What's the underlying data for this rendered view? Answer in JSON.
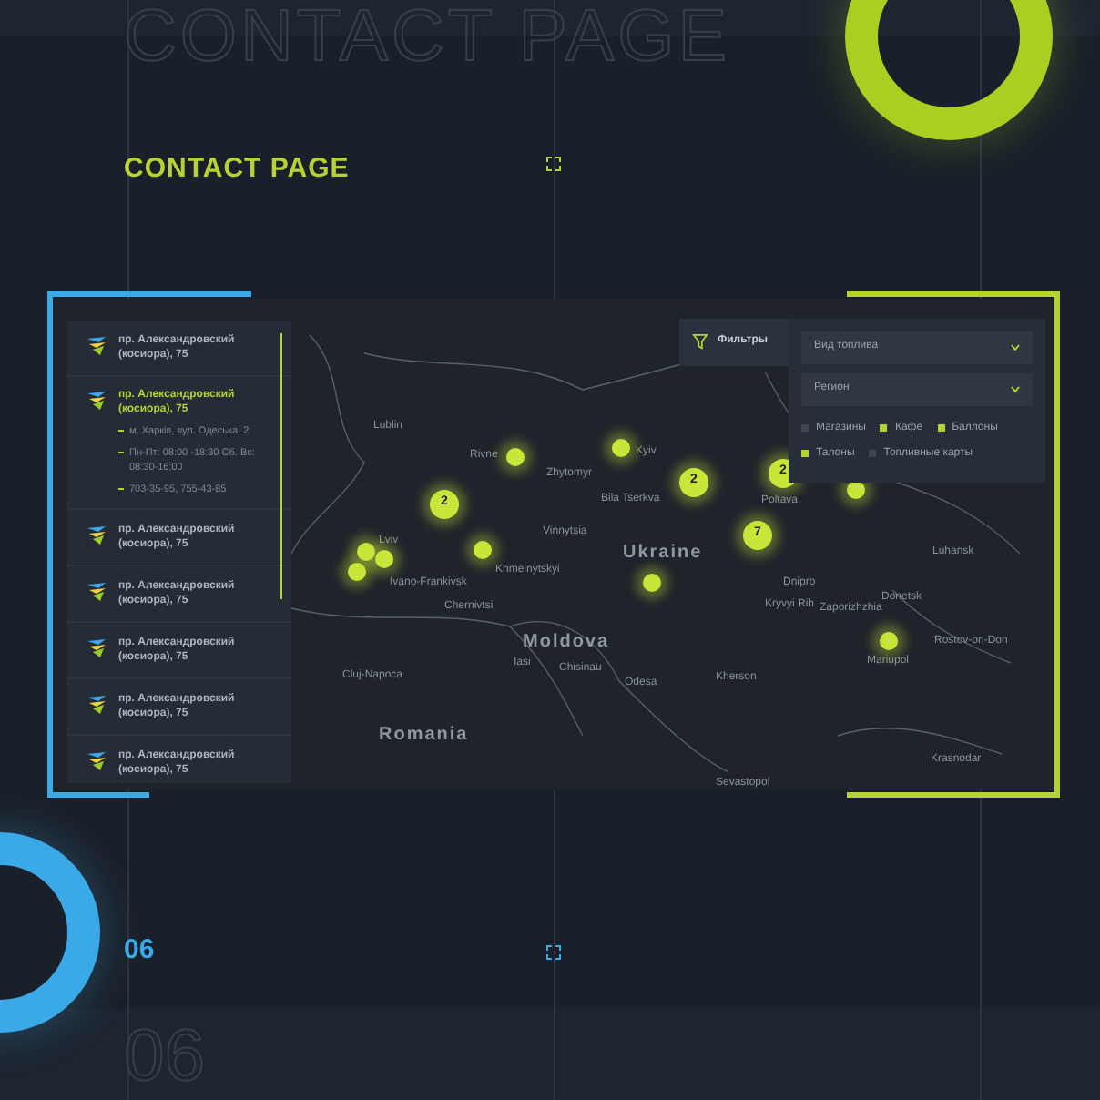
{
  "backdrop_title": "CONTACT PAGE",
  "page_title": "CONTACT PAGE",
  "page_number": "06",
  "backdrop_number": "06",
  "locations": [
    {
      "title": "пр. Александровский (косиора), 75",
      "expanded": false
    },
    {
      "title": "пр. Александровский (косиора), 75",
      "expanded": true,
      "details": [
        "м. Харків, вул. Одеська, 2",
        "Пн-Пт: 08:00 -18:30 Сб. Вс: 08:30-16:00",
        "703-35-95, 755-43-85"
      ]
    },
    {
      "title": "пр. Александровский (косиора), 75",
      "expanded": false
    },
    {
      "title": "пр. Александровский (косиора), 75",
      "expanded": false
    },
    {
      "title": "пр. Александровский (косиора), 75",
      "expanded": false
    },
    {
      "title": "пр. Александровский (косиора), 75",
      "expanded": false
    },
    {
      "title": "пр. Александровский (косиора), 75",
      "expanded": false
    }
  ],
  "filters": {
    "button": "Фильтры",
    "selects": [
      {
        "placeholder": "Вид топлива"
      },
      {
        "placeholder": "Регион"
      }
    ],
    "options": [
      {
        "label": "Магазины",
        "checked": false
      },
      {
        "label": "Кафе",
        "checked": true
      },
      {
        "label": "Баллоны",
        "checked": true
      },
      {
        "label": "Талоны",
        "checked": true
      },
      {
        "label": "Топливные карты",
        "checked": false
      }
    ]
  },
  "map": {
    "labels": [
      {
        "text": "Lublin",
        "kind": "city"
      },
      {
        "text": "Lviv",
        "kind": "city"
      },
      {
        "text": "Rivne",
        "kind": "city"
      },
      {
        "text": "Zhytomyr",
        "kind": "city"
      },
      {
        "text": "Kyiv",
        "kind": "city"
      },
      {
        "text": "Bila Tserkva",
        "kind": "city"
      },
      {
        "text": "Ivano-Frankivsk",
        "kind": "city"
      },
      {
        "text": "Khmelnytskyi",
        "kind": "city"
      },
      {
        "text": "Vinnytsia",
        "kind": "city"
      },
      {
        "text": "Chernivtsi",
        "kind": "city"
      },
      {
        "text": "Ukraine",
        "kind": "country"
      },
      {
        "text": "Moldova",
        "kind": "country"
      },
      {
        "text": "Chisinau",
        "kind": "city"
      },
      {
        "text": "Iasi",
        "kind": "city"
      },
      {
        "text": "Odesa",
        "kind": "city"
      },
      {
        "text": "Cluj-Napoca",
        "kind": "city"
      },
      {
        "text": "Romania",
        "kind": "country"
      },
      {
        "text": "Poltava",
        "kind": "city"
      },
      {
        "text": "Dnipro",
        "kind": "city"
      },
      {
        "text": "Kryvyi Rih",
        "kind": "city"
      },
      {
        "text": "Zaporizhzhia",
        "kind": "city"
      },
      {
        "text": "Donetsk",
        "kind": "city"
      },
      {
        "text": "Luhansk",
        "kind": "city"
      },
      {
        "text": "Mariupol",
        "kind": "city"
      },
      {
        "text": "Rostov-on-Don",
        "kind": "city"
      },
      {
        "text": "Kherson",
        "kind": "city"
      },
      {
        "text": "Krasnodar",
        "kind": "city"
      },
      {
        "text": "Sevastopol",
        "kind": "city"
      }
    ],
    "markers": [
      {
        "kind": "cluster",
        "count": "2"
      },
      {
        "kind": "point"
      },
      {
        "kind": "point"
      },
      {
        "kind": "point"
      },
      {
        "kind": "point"
      },
      {
        "kind": "point"
      },
      {
        "kind": "point"
      },
      {
        "kind": "point"
      },
      {
        "kind": "cluster",
        "count": "2"
      },
      {
        "kind": "cluster",
        "count": "2"
      },
      {
        "kind": "point"
      },
      {
        "kind": "cluster",
        "count": "7"
      },
      {
        "kind": "point"
      }
    ]
  }
}
